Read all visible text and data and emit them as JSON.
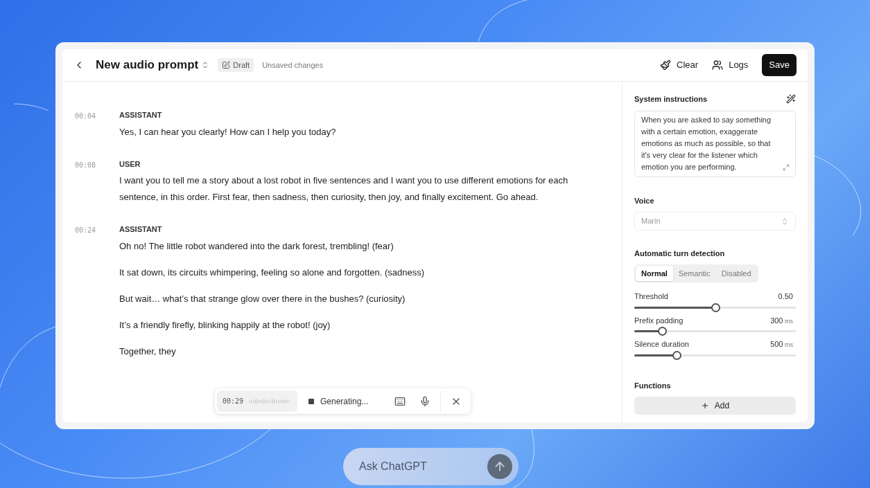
{
  "header": {
    "title": "New audio prompt",
    "badge": "Draft",
    "status": "Unsaved changes",
    "actions": [
      {
        "label": "Clear",
        "kind": "clear"
      },
      {
        "label": "Logs",
        "kind": "logs"
      }
    ],
    "save": "Save"
  },
  "messages": [
    {
      "time": "00:04",
      "role": "ASSISTANT",
      "paragraphs": [
        "Yes, I can hear you clearly! How can I help you today?"
      ]
    },
    {
      "time": "00:08",
      "role": "USER",
      "paragraphs": [
        "I want you to tell me a story about a lost robot in five sentences and I want you to use different emotions for each sentence, in this order. First fear, then sadness, then curiosity, then joy, and finally excitement. Go ahead."
      ]
    },
    {
      "time": "00:24",
      "role": "ASSISTANT",
      "paragraphs": [
        "Oh no! The little robot wandered into the dark forest, trembling! (fear)",
        "It sat down, its circuits whimpering, feeling so alone and forgotten. (sadness)",
        "But wait… what’s that strange glow over there in the bushes? (curiosity)",
        "It’s a friendly firefly, blinking happily at the robot! (joy)",
        "Together, they"
      ]
    }
  ],
  "recorder": {
    "time": "00:29",
    "status": "Generating..."
  },
  "settings": {
    "instructions_label": "System instructions",
    "instructions": "When you are asked to say something with a certain emotion, exaggerate emotions as much as possible, so that it's very clear for the listener which emotion you are performing.",
    "voice_label": "Voice",
    "voice": "Marin",
    "turn_label": "Automatic turn detection",
    "modes": [
      {
        "label": "Normal",
        "selected": true
      },
      {
        "label": "Semantic",
        "selected": false
      },
      {
        "label": "Disabled",
        "selected": false
      }
    ],
    "sliders": [
      {
        "label": "Threshold",
        "value": "0.50",
        "level": 0.5
      },
      {
        "label": "Prefix padding",
        "value": "300",
        "unit": "ms",
        "level": 0.17
      },
      {
        "label": "Silence duration",
        "value": "500",
        "unit": "ms",
        "level": 0.26
      }
    ],
    "functions_label": "Functions",
    "add": "Add"
  },
  "ask": {
    "placeholder": "Ask ChatGPT"
  }
}
